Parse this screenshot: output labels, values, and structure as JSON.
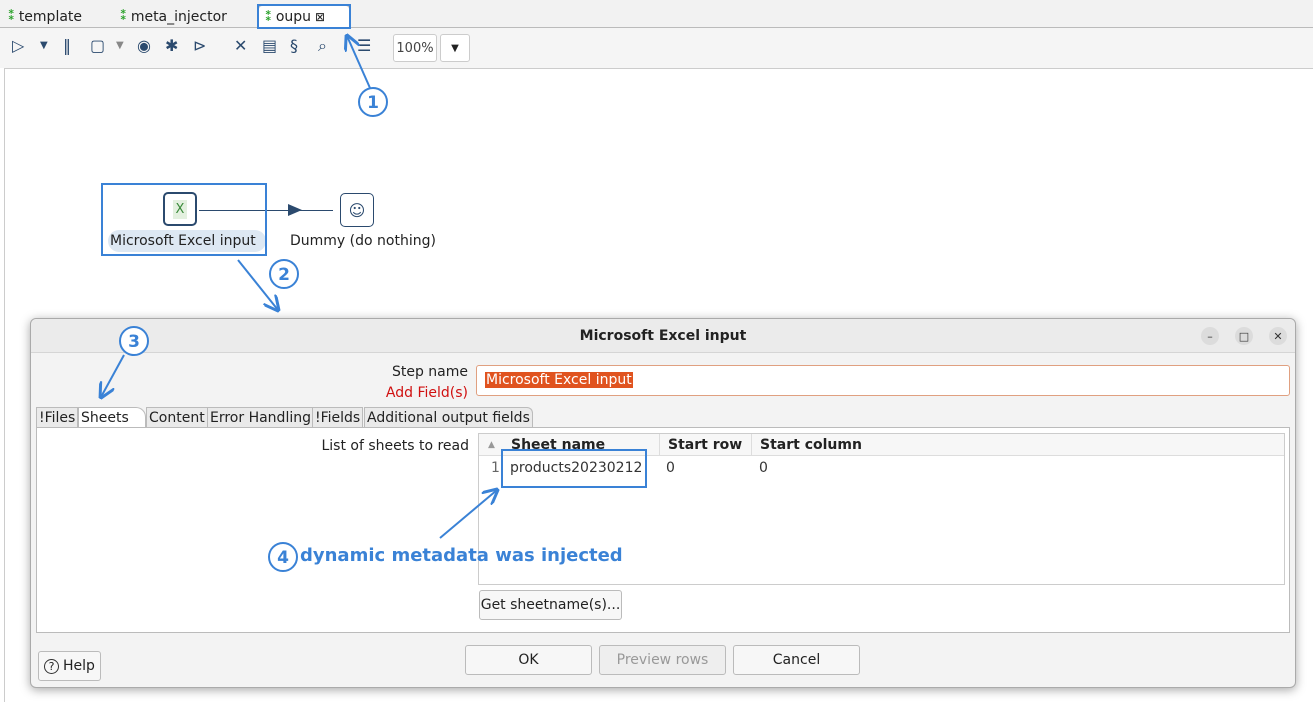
{
  "file_tabs": [
    {
      "label": "template"
    },
    {
      "label": "meta_injector"
    },
    {
      "label": "oupu",
      "active": true,
      "close": "⊠"
    }
  ],
  "toolbar": {
    "zoom": "100%",
    "icons": [
      "run-icon",
      "dropdown-icon",
      "pause-icon",
      "stop-icon",
      "dropdown-icon",
      "preview-icon",
      "debug-icon",
      "replay-icon",
      "verify-icon",
      "impact-icon",
      "sql-icon",
      "explore-db-icon",
      "layout-icon"
    ]
  },
  "canvas": {
    "steps": [
      {
        "label": "Microsoft Excel input",
        "icon": "excel-file-icon"
      },
      {
        "label": "Dummy (do nothing)",
        "icon": "dummy-head-icon"
      }
    ]
  },
  "dialog": {
    "title": "Microsoft Excel input",
    "step_name_label": "Step name",
    "add_fields_label": "Add Field(s)",
    "step_name_value": "Microsoft Excel input",
    "tabs": [
      "!Files",
      "Sheets",
      "Content",
      "Error Handling",
      "!Fields",
      "Additional output fields"
    ],
    "active_tab": "Sheets",
    "list_label": "List of sheets to read",
    "columns": [
      "Sheet name",
      "Start row",
      "Start column"
    ],
    "rows": [
      {
        "num": "1",
        "sheet": "products20230212",
        "start_row": "0",
        "start_col": "0"
      }
    ],
    "get_sheetnames": "Get sheetname(s)...",
    "help": "Help",
    "ok": "OK",
    "preview": "Preview rows",
    "cancel": "Cancel"
  },
  "annotations": {
    "n1": "1",
    "n2": "2",
    "n3": "3",
    "n4": "4",
    "note": "dynamic metadata was injected",
    "color": "#3a82d6"
  }
}
